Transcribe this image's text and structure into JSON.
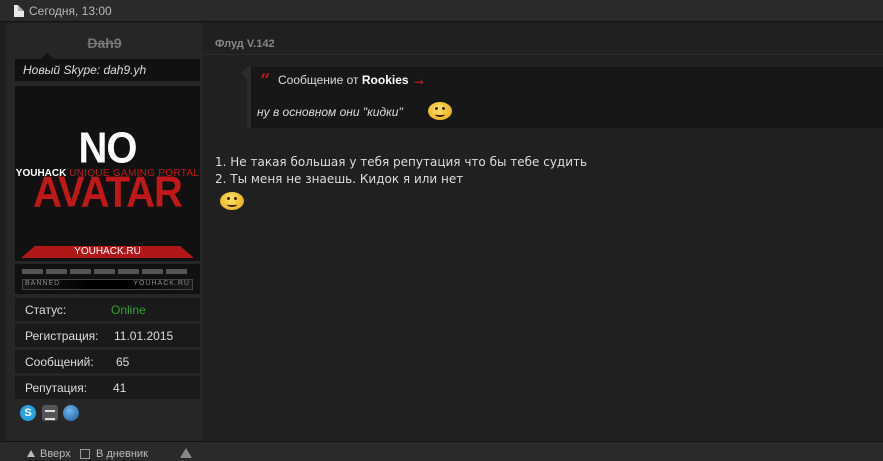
{
  "topbar": {
    "date": "Сегодня, 13:00",
    "icon": "document-icon"
  },
  "profile": {
    "username": "Dah9",
    "status_message": "Новый Skype: dah9.yh",
    "avatar": {
      "line1_white": "NO ",
      "line1_red": "AVATAR",
      "line2_white": "YOUHACK ",
      "line2_red": "UNIQUE GAMING PORTAL",
      "bar_text": "YOUHACK.RU"
    },
    "rank": {
      "left_label": "BANNED",
      "right_label": "YOUHACK.RU"
    },
    "info": [
      {
        "label": "Статус:",
        "value": "Online"
      },
      {
        "label": "Регистрация:",
        "value": "11.01.2015"
      },
      {
        "label": "Сообщений:",
        "value": "65"
      },
      {
        "label": "Репутация:",
        "value": "41"
      }
    ],
    "contacts": [
      "skype-icon",
      "steam-icon",
      "website-icon"
    ],
    "colors": {
      "online": "#2aa52a",
      "accent": "#c01818"
    }
  },
  "post": {
    "thread": "Флуд V.142",
    "quote": {
      "prefix": "Сообщение от ",
      "author": "Rookies",
      "text": "ну в основном они \"кидки\""
    },
    "lines": [
      "1. Не такая большая у тебя репутация что бы тебе судить",
      "2. Ты меня не знаешь. Кидок я или нет"
    ]
  },
  "footer": {
    "up": "Вверх",
    "diary": "В дневник"
  }
}
